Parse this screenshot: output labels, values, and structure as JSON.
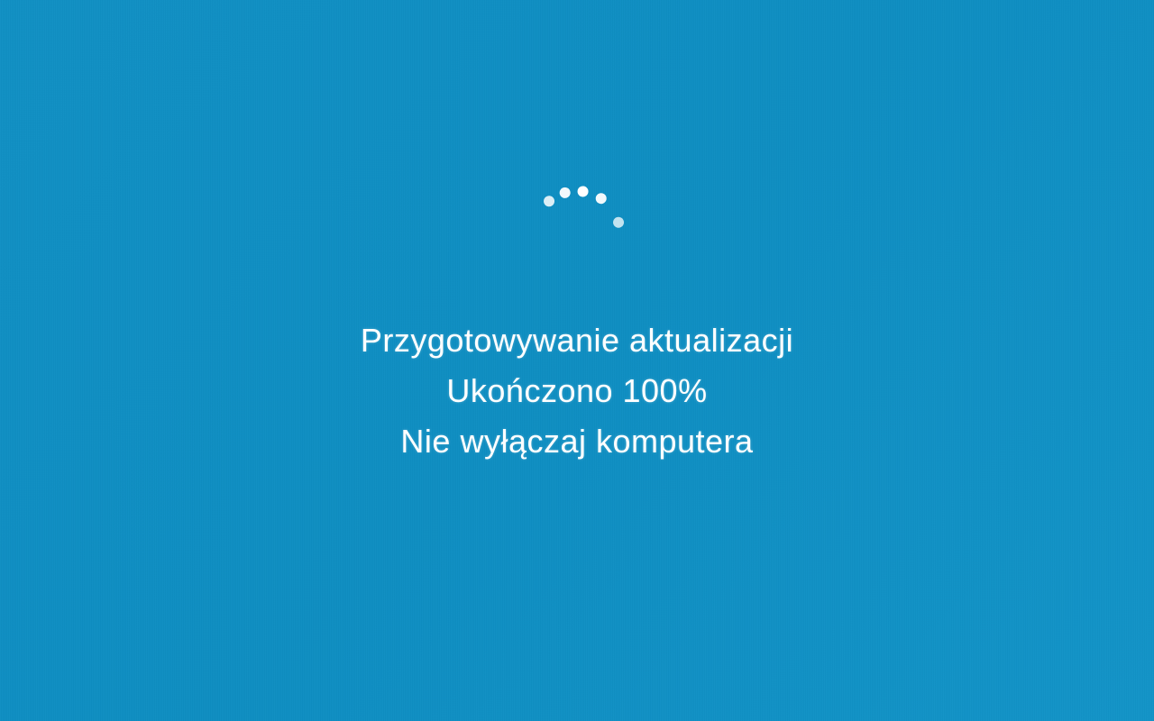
{
  "update": {
    "line1": "Przygotowywanie aktualizacji",
    "line2": "Ukończono 100%",
    "line3": "Nie wyłączaj komputera"
  },
  "colors": {
    "background": "#0e8ec2",
    "text": "#ffffff"
  },
  "spinner": {
    "dot_count": 5,
    "radius": 48
  }
}
